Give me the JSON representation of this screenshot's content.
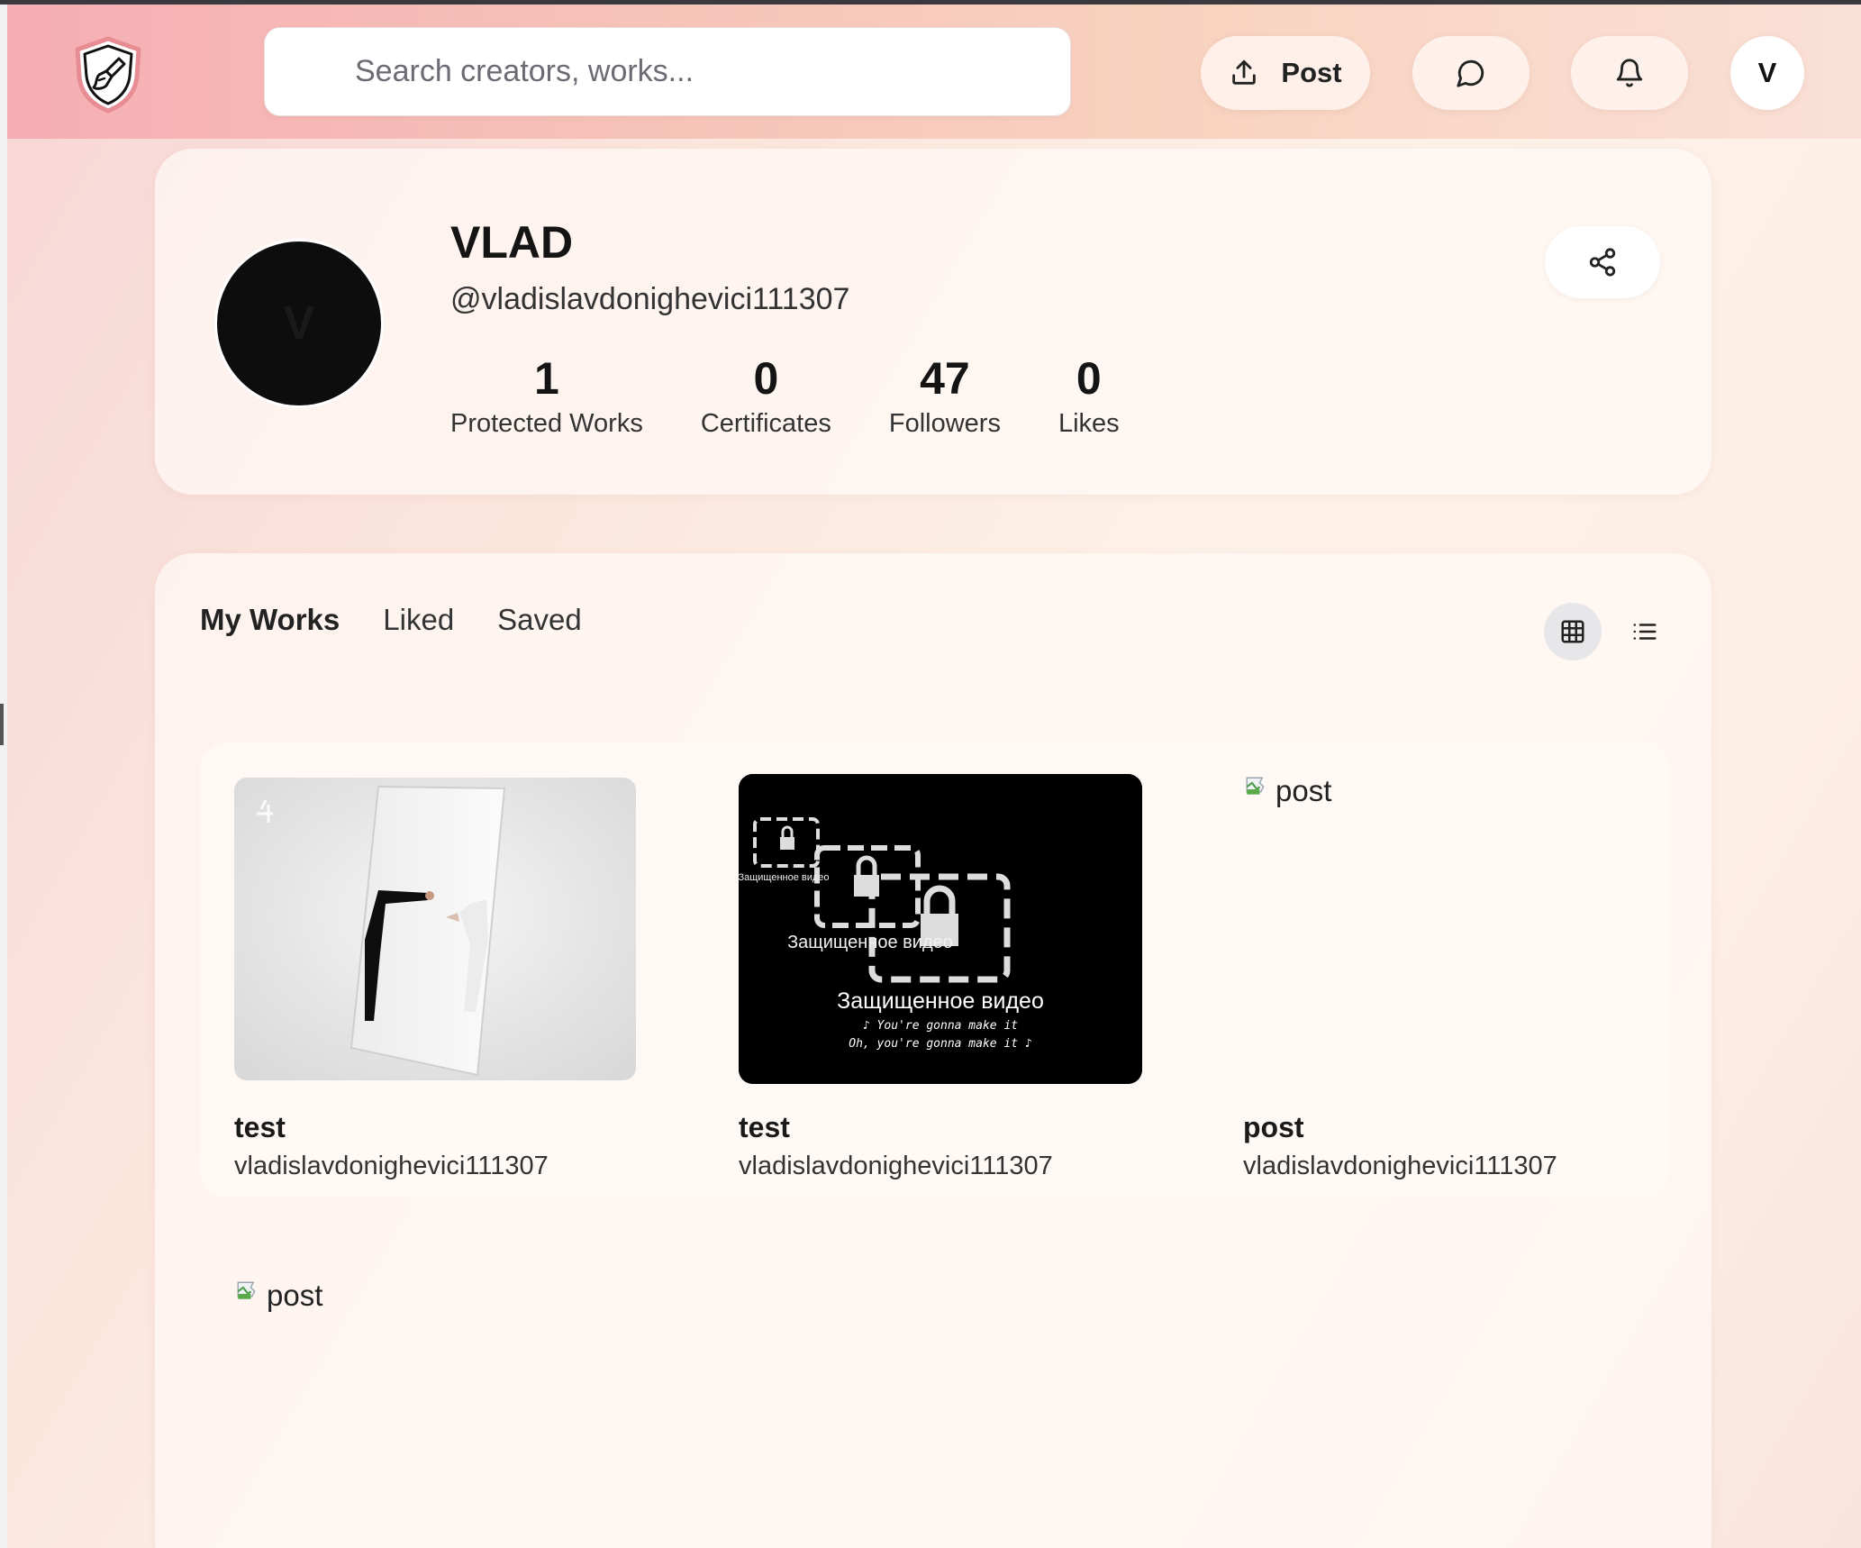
{
  "header": {
    "search_placeholder": "Search creators, works...",
    "post_label": "Post",
    "avatar_initial": "V"
  },
  "profile": {
    "avatar_initial": "V",
    "name": "VLAD",
    "handle": "@vladislavdonighevici111307",
    "stats": [
      {
        "value": "1",
        "label": "Protected Works"
      },
      {
        "value": "0",
        "label": "Certificates"
      },
      {
        "value": "47",
        "label": "Followers"
      },
      {
        "value": "0",
        "label": "Likes"
      }
    ]
  },
  "works_section": {
    "tabs": [
      {
        "label": "My Works",
        "active": true
      },
      {
        "label": "Liked",
        "active": false
      },
      {
        "label": "Saved",
        "active": false
      }
    ],
    "view_mode": "grid",
    "items": [
      {
        "title": "test",
        "author": "vladislavdonighevici111307",
        "thumb": "mirror-photo"
      },
      {
        "title": "test",
        "author": "vladislavdonighevici111307",
        "thumb": "protected-video",
        "thumb_text": {
          "caption_small": "Защищенное видео",
          "caption_mid": "Защищенное видео",
          "caption_main": "Защищенное видео",
          "lyric_1": "♪ You're gonna make it",
          "lyric_2": "Oh, you're gonna make it ♪"
        }
      },
      {
        "title": "post",
        "author": "vladislavdonighevici111307",
        "thumb": "broken-image",
        "alt": "post"
      },
      {
        "title": "",
        "author": "",
        "thumb": "broken-image",
        "alt": "post"
      }
    ]
  },
  "colors": {
    "header_start": "#f5aeb4",
    "header_end": "#fae0d6",
    "accent_dark": "#141414"
  }
}
